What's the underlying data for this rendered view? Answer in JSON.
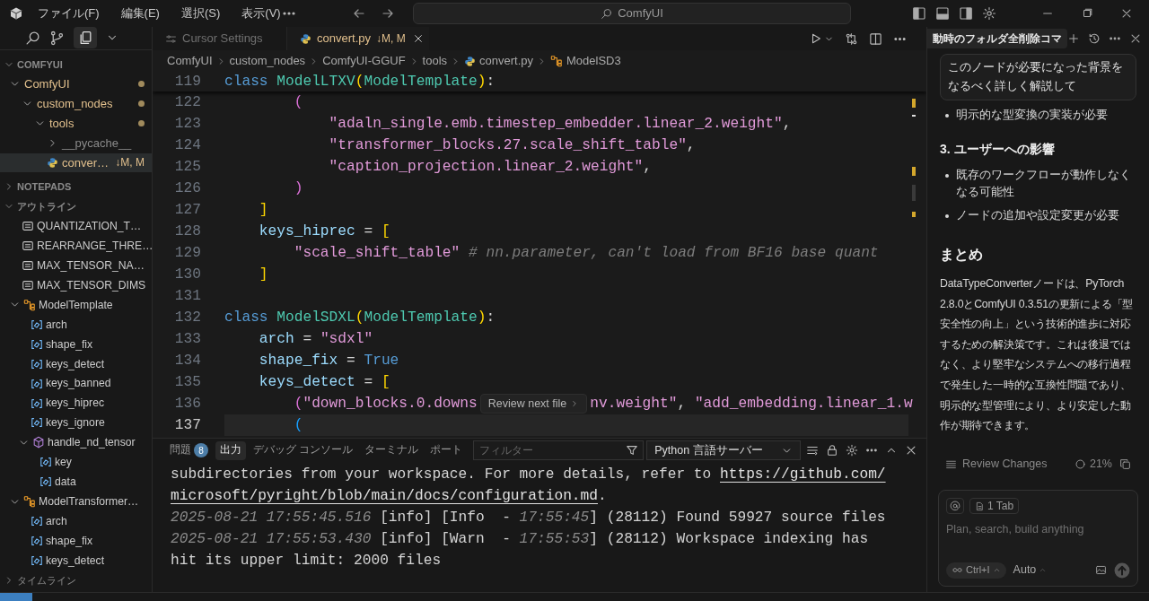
{
  "titlebar": {
    "menus": [
      "ファイル(F)",
      "編集(E)",
      "選択(S)",
      "表示(V)"
    ],
    "search": "ComfyUI"
  },
  "sidebar": {
    "root": {
      "label": "COMFYUI",
      "expanded": true
    },
    "tree": [
      {
        "label": "ComfyUI",
        "kind": "folder",
        "expanded": true,
        "modified": true,
        "selected": false,
        "children": [
          {
            "label": "custom_nodes",
            "kind": "folder",
            "expanded": true,
            "modified": true,
            "selected": false,
            "children": [
              {
                "label": "tools",
                "kind": "folder",
                "expanded": true,
                "modified": true,
                "selected": false,
                "children": [
                  {
                    "label": "__pycache__",
                    "kind": "folder",
                    "expanded": false,
                    "modified": false,
                    "selected": false
                  },
                  {
                    "label": "conver…",
                    "kind": "python",
                    "status": "↓M, M",
                    "modified": true,
                    "selected": true
                  }
                ]
              }
            ]
          }
        ]
      }
    ],
    "notepads": {
      "label": "NOTEPADS",
      "expanded": false
    },
    "outline_header": {
      "label": "アウトライン",
      "expanded": true
    },
    "outline": [
      {
        "label": "QUANTIZATION_T…",
        "kind": "constant"
      },
      {
        "label": "REARRANGE_THRE…",
        "kind": "constant"
      },
      {
        "label": "MAX_TENSOR_NA…",
        "kind": "constant"
      },
      {
        "label": "MAX_TENSOR_DIMS",
        "kind": "constant"
      },
      {
        "label": "ModelTemplate",
        "kind": "class",
        "expanded": true,
        "children": [
          {
            "label": "arch",
            "kind": "field"
          },
          {
            "label": "shape_fix",
            "kind": "field"
          },
          {
            "label": "keys_detect",
            "kind": "field"
          },
          {
            "label": "keys_banned",
            "kind": "field"
          },
          {
            "label": "keys_hiprec",
            "kind": "field"
          },
          {
            "label": "keys_ignore",
            "kind": "field"
          },
          {
            "label": "handle_nd_tensor",
            "kind": "method",
            "expanded": true,
            "children": [
              {
                "label": "key",
                "kind": "field"
              },
              {
                "label": "data",
                "kind": "field"
              }
            ]
          }
        ]
      },
      {
        "label": "ModelTransformer…",
        "kind": "class",
        "expanded": true,
        "children": [
          {
            "label": "arch",
            "kind": "field"
          },
          {
            "label": "shape_fix",
            "kind": "field"
          },
          {
            "label": "keys_detect",
            "kind": "field"
          }
        ]
      }
    ],
    "timeline": {
      "label": "タイムライン",
      "expanded": false
    }
  },
  "editor": {
    "tabs": [
      {
        "label": "Cursor Settings",
        "kind": "settings",
        "selected": false
      },
      {
        "label": "convert.py",
        "kind": "python",
        "status": "↓M, M",
        "selected": true
      }
    ],
    "breadcrumb": [
      {
        "label": "ComfyUI",
        "kind": "folder"
      },
      {
        "label": "custom_nodes",
        "kind": "folder"
      },
      {
        "label": "ComfyUI-GGUF",
        "kind": "folder"
      },
      {
        "label": "tools",
        "kind": "folder"
      },
      {
        "label": "convert.py",
        "kind": "python"
      },
      {
        "label": "ModelSD3",
        "kind": "class"
      }
    ],
    "sticky": {
      "n": "119",
      "tokens": [
        {
          "kind": "keyword",
          "text": "class "
        },
        {
          "kind": "type",
          "text": "ModelLTXV"
        },
        {
          "kind": "bracket1",
          "text": "("
        },
        {
          "kind": "type",
          "text": "ModelTemplate"
        },
        {
          "kind": "bracket1",
          "text": ")"
        },
        {
          "kind": "plain",
          "text": ":"
        }
      ]
    },
    "lines": [
      {
        "n": "122",
        "current": false,
        "tokens": [
          {
            "kind": "bracket2",
            "text": "        ("
          }
        ]
      },
      {
        "n": "123",
        "current": false,
        "tokens": [
          {
            "kind": "string",
            "text": "            \"adaln_single.emb.timestep_embedder.linear_2.weight\""
          },
          {
            "kind": "plain",
            "text": ","
          }
        ]
      },
      {
        "n": "124",
        "current": false,
        "tokens": [
          {
            "kind": "string",
            "text": "            \"transformer_blocks.27.scale_shift_table\""
          },
          {
            "kind": "plain",
            "text": ","
          }
        ]
      },
      {
        "n": "125",
        "current": false,
        "tokens": [
          {
            "kind": "string",
            "text": "            \"caption_projection.linear_2.weight\""
          },
          {
            "kind": "plain",
            "text": ","
          }
        ]
      },
      {
        "n": "126",
        "current": false,
        "tokens": [
          {
            "kind": "bracket2",
            "text": "        )"
          }
        ]
      },
      {
        "n": "127",
        "current": false,
        "tokens": [
          {
            "kind": "bracket1",
            "text": "    ]"
          }
        ]
      },
      {
        "n": "128",
        "current": false,
        "tokens": [
          {
            "kind": "variable",
            "text": "    keys_hiprec"
          },
          {
            "kind": "plain",
            "text": " = "
          },
          {
            "kind": "bracket1",
            "text": "["
          }
        ]
      },
      {
        "n": "129",
        "current": false,
        "tokens": [
          {
            "kind": "string",
            "text": "        \"scale_shift_table\""
          },
          {
            "kind": "comment",
            "text": " # nn.parameter, can't load from BF16 base quant"
          }
        ]
      },
      {
        "n": "130",
        "current": false,
        "tokens": [
          {
            "kind": "bracket1",
            "text": "    ]"
          }
        ]
      },
      {
        "n": "131",
        "current": false
      },
      {
        "n": "132",
        "current": false,
        "tokens": [
          {
            "kind": "keyword",
            "text": "class "
          },
          {
            "kind": "type",
            "text": "ModelSDXL"
          },
          {
            "kind": "bracket1",
            "text": "("
          },
          {
            "kind": "type",
            "text": "ModelTemplate"
          },
          {
            "kind": "bracket1",
            "text": ")"
          },
          {
            "kind": "plain",
            "text": ":"
          }
        ]
      },
      {
        "n": "133",
        "current": false,
        "tokens": [
          {
            "kind": "variable",
            "text": "    arch"
          },
          {
            "kind": "plain",
            "text": " = "
          },
          {
            "kind": "string",
            "text": "\"sdxl\""
          }
        ]
      },
      {
        "n": "134",
        "current": false,
        "tokens": [
          {
            "kind": "variable",
            "text": "    shape_fix"
          },
          {
            "kind": "plain",
            "text": " = "
          },
          {
            "kind": "keyword",
            "text": "True"
          }
        ]
      },
      {
        "n": "135",
        "current": false,
        "tokens": [
          {
            "kind": "variable",
            "text": "    keys_detect"
          },
          {
            "kind": "plain",
            "text": " = "
          },
          {
            "kind": "bracket1",
            "text": "["
          }
        ]
      },
      {
        "n": "136",
        "current": false,
        "tokens": [
          {
            "kind": "bracket2",
            "text": "        ("
          },
          {
            "kind": "string",
            "text": "\"down_blocks.0.downs"
          }
        ],
        "hover": "Review next file",
        "after": [
          {
            "kind": "string",
            "text": "nv.weight\""
          },
          {
            "kind": "plain",
            "text": ", "
          },
          {
            "kind": "string",
            "text": "\"add_embedding.linear_1.w"
          }
        ]
      },
      {
        "n": "137",
        "current": true,
        "tokens": [
          {
            "kind": "bracket3",
            "text": "        ("
          }
        ]
      }
    ]
  },
  "panel": {
    "tabs": [
      {
        "label": "問題",
        "badge": "8",
        "selected": false
      },
      {
        "label": "出力",
        "selected": true
      },
      {
        "label": "デバッグ コンソール",
        "selected": false
      },
      {
        "label": "ターミナル",
        "selected": false
      },
      {
        "label": "ポート",
        "selected": false
      }
    ],
    "filter_placeholder": "フィルター",
    "channel": "Python 言語サーバー",
    "output": [
      [
        {
          "kind": "plain",
          "text": "subdirectories from your workspace. For more details, refer to "
        },
        {
          "kind": "link",
          "text": "https://github.com/"
        }
      ],
      [
        {
          "kind": "link",
          "text": "microsoft/pyright/blob/main/docs/configuration.md"
        },
        {
          "kind": "plain",
          "text": "."
        }
      ],
      [
        {
          "kind": "timestamp",
          "text": "2025-08-21 17:55:45.516"
        },
        {
          "kind": "plain",
          "text": " [info] [Info  - "
        },
        {
          "kind": "timestamp",
          "text": "17:55:45"
        },
        {
          "kind": "plain",
          "text": "] (28112) Found 59927 source files"
        }
      ],
      [
        {
          "kind": "timestamp",
          "text": "2025-08-21 17:55:53.430"
        },
        {
          "kind": "plain",
          "text": " [info] [Warn  - "
        },
        {
          "kind": "timestamp",
          "text": "17:55:53"
        },
        {
          "kind": "plain",
          "text": "] (28112) Workspace indexing has"
        }
      ],
      [
        {
          "kind": "plain",
          "text": "hit its upper limit: 2000 files"
        }
      ]
    ]
  },
  "chat": {
    "title": "動時のフォルダ全削除コマ",
    "user_message": "このノードが必要になった背景をなるべく詳しく解説して",
    "blocks": [
      {
        "kind": "bullet",
        "text": "明示的な型変換の実装が必要"
      },
      {
        "kind": "heading3",
        "text": "3. ユーザーへの影響"
      },
      {
        "kind": "bullet",
        "text": "既存のワークフローが動作しなくなる可能性"
      },
      {
        "kind": "bullet",
        "text": "ノードの追加や設定変更が必要"
      },
      {
        "kind": "heading2",
        "text": "まとめ"
      },
      {
        "kind": "paragraph",
        "text": "DataTypeConverterノードは、PyTorch 2.8.0とComfyUI 0.3.51の更新による「型安全性の向上」という技術的進歩に対応するための解決策です。これは後退ではなく、より堅牢なシステムへの移行過程で発生した一時的な互換性問題であり、明示的な型管理により、より安定した動作が期待できます。"
      }
    ],
    "review": "Review Changes",
    "progress": "21%",
    "composer": {
      "context": "1 Tab",
      "placeholder": "Plan, search, build anything",
      "shortcut": "Ctrl+I",
      "model": "Auto"
    }
  }
}
